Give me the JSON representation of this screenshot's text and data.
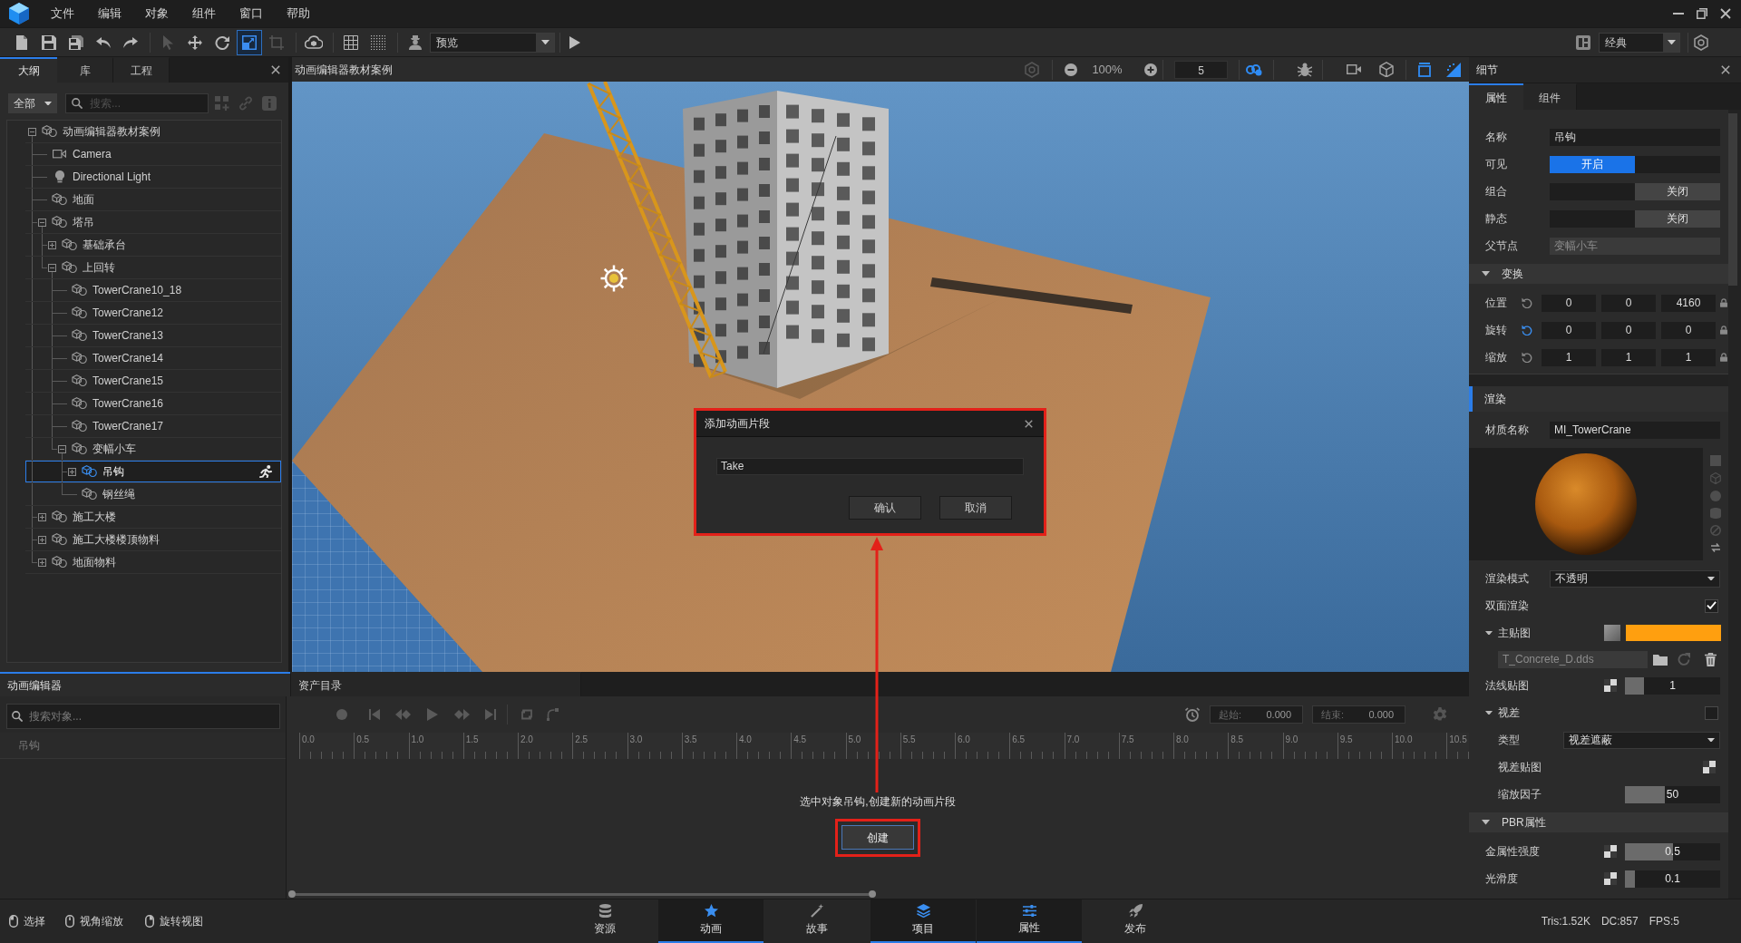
{
  "menu_bar": {
    "menus": [
      "文件",
      "编辑",
      "对象",
      "组件",
      "窗口",
      "帮助"
    ]
  },
  "toolbar": {
    "groups": [
      {
        "tools": [
          {
            "kind": "new",
            "selected": false,
            "disabled": false
          },
          {
            "kind": "save",
            "selected": false,
            "disabled": false
          },
          {
            "kind": "save-all",
            "selected": false,
            "disabled": false
          },
          {
            "kind": "undo",
            "selected": false,
            "disabled": false
          },
          {
            "kind": "redo",
            "selected": false,
            "disabled": false
          }
        ]
      },
      {
        "tools": [
          {
            "kind": "select",
            "selected": false,
            "disabled": true
          },
          {
            "kind": "move",
            "selected": false,
            "disabled": false
          },
          {
            "kind": "rotate",
            "selected": false,
            "disabled": false
          },
          {
            "kind": "scale",
            "selected": true,
            "disabled": false
          },
          {
            "kind": "snap",
            "selected": false,
            "disabled": true
          }
        ]
      },
      {
        "tools": [
          {
            "kind": "cloud",
            "selected": false,
            "disabled": false
          }
        ]
      },
      {
        "tools": [
          {
            "kind": "grid",
            "selected": false,
            "disabled": false
          },
          {
            "kind": "dot-grid",
            "selected": false,
            "disabled": false
          }
        ]
      }
    ],
    "preview_dropdown": "预览",
    "layout_dropdown": "经典"
  },
  "outliner": {
    "tabs": [
      {
        "label": "大纲",
        "selected": true
      },
      {
        "label": "库",
        "selected": false
      },
      {
        "label": "工程",
        "selected": false
      }
    ],
    "filter": "全部",
    "search_placeholder": "搜索...",
    "tree": [
      {
        "label": "动画编辑器教材案例",
        "kind": "object",
        "expanded": true,
        "selected": false,
        "animated": false,
        "children": [
          {
            "label": "Camera",
            "kind": "camera",
            "selected": false,
            "animated": false
          },
          {
            "label": "Directional Light",
            "kind": "light",
            "selected": false,
            "animated": false
          },
          {
            "label": "地面",
            "kind": "object",
            "selected": false,
            "animated": false
          },
          {
            "label": "塔吊",
            "kind": "object",
            "expanded": true,
            "selected": false,
            "animated": false,
            "children": [
              {
                "label": "基础承台",
                "kind": "object",
                "expanded": false,
                "selected": false,
                "animated": false
              },
              {
                "label": "上回转",
                "kind": "object",
                "expanded": true,
                "selected": false,
                "animated": false,
                "children": [
                  {
                    "label": "TowerCrane10_18",
                    "kind": "object",
                    "selected": false,
                    "animated": false
                  },
                  {
                    "label": "TowerCrane12",
                    "kind": "object",
                    "selected": false,
                    "animated": false
                  },
                  {
                    "label": "TowerCrane13",
                    "kind": "object",
                    "selected": false,
                    "animated": false
                  },
                  {
                    "label": "TowerCrane14",
                    "kind": "object",
                    "selected": false,
                    "animated": false
                  },
                  {
                    "label": "TowerCrane15",
                    "kind": "object",
                    "selected": false,
                    "animated": false
                  },
                  {
                    "label": "TowerCrane16",
                    "kind": "object",
                    "selected": false,
                    "animated": false
                  },
                  {
                    "label": "TowerCrane17",
                    "kind": "object",
                    "selected": false,
                    "animated": false
                  },
                  {
                    "label": "变幅小车",
                    "kind": "object",
                    "expanded": true,
                    "selected": false,
                    "animated": false,
                    "children": [
                      {
                        "label": "吊钩",
                        "kind": "object",
                        "expanded": false,
                        "selected": true,
                        "animated": true
                      },
                      {
                        "label": "钢丝绳",
                        "kind": "object",
                        "selected": false,
                        "animated": false
                      }
                    ]
                  }
                ]
              }
            ]
          },
          {
            "label": "施工大楼",
            "kind": "object",
            "expanded": false,
            "selected": false,
            "animated": false
          },
          {
            "label": "施工大楼楼顶物料",
            "kind": "object",
            "expanded": false,
            "selected": false,
            "animated": false
          },
          {
            "label": "地面物料",
            "kind": "object",
            "expanded": false,
            "selected": false,
            "animated": false
          }
        ]
      }
    ]
  },
  "viewport": {
    "title": "动画编辑器教材案例",
    "zoom": "100%",
    "number_field": "5",
    "tools": [
      {
        "kind": "link",
        "on": true
      },
      {
        "kind": "bug",
        "on": false
      },
      {
        "kind": "video-camera",
        "on": false
      },
      {
        "kind": "cube",
        "on": false
      },
      {
        "kind": "panel",
        "on": true
      },
      {
        "kind": "gradient",
        "on": true
      }
    ]
  },
  "dialog": {
    "title": "添加动画片段",
    "value": "Take",
    "buttons": [
      "确认",
      "取消"
    ],
    "highlighted": true
  },
  "details": {
    "title": "细节",
    "tabs": [
      {
        "label": "属性",
        "selected": true
      },
      {
        "label": "组件",
        "selected": false
      }
    ],
    "sections": [
      {
        "kind": "plain",
        "rows": [
          {
            "kind": "text",
            "label": "名称",
            "value": "吊钩",
            "disabled": false
          },
          {
            "kind": "toggle",
            "label": "可见",
            "on": true,
            "text": "开启"
          },
          {
            "kind": "toggle",
            "label": "组合",
            "on": false,
            "text": "关闭"
          },
          {
            "kind": "toggle",
            "label": "静态",
            "on": false,
            "text": "关闭"
          },
          {
            "kind": "text",
            "label": "父节点",
            "value": "变幅小车",
            "disabled": true
          }
        ]
      },
      {
        "kind": "group",
        "title": "变换",
        "expanded": true,
        "rows": [
          {
            "kind": "vector",
            "label": "位置",
            "values": [
              "0",
              "0",
              "4160"
            ],
            "highlighted": false
          },
          {
            "kind": "vector",
            "label": "旋转",
            "values": [
              "0",
              "0",
              "0"
            ],
            "highlighted": true
          },
          {
            "kind": "vector",
            "label": "缩放",
            "values": [
              "1",
              "1",
              "1"
            ],
            "highlighted": false
          }
        ]
      },
      {
        "kind": "category",
        "title": "渲染",
        "rows": [
          {
            "kind": "text",
            "label": "材质名称",
            "value": "MI_TowerCrane",
            "disabled": false
          },
          {
            "kind": "material-preview"
          },
          {
            "kind": "dropdown",
            "label": "渲染模式",
            "value": "不透明"
          },
          {
            "kind": "checkbox",
            "label": "双面渲染",
            "checked": true
          },
          {
            "kind": "texture",
            "label": "主贴图",
            "expanded": true,
            "color": "#ff9f0f",
            "children": [
              {
                "kind": "file",
                "value": "T_Concrete_D.dds"
              }
            ]
          },
          {
            "kind": "slider",
            "label": "法线贴图",
            "map": true,
            "level": 0.2,
            "value": "1"
          },
          {
            "kind": "group",
            "label": "视差",
            "expanded": true,
            "checked": false,
            "children": [
              {
                "kind": "dropdown",
                "label": "类型",
                "value": "视差遮蔽"
              },
              {
                "kind": "map",
                "label": "视差贴图"
              },
              {
                "kind": "slider",
                "label": "缩放因子",
                "map": false,
                "level": 0.42,
                "value": "50"
              }
            ]
          }
        ]
      },
      {
        "kind": "group",
        "title": "PBR属性",
        "expanded": true,
        "rows": [
          {
            "kind": "slider",
            "label": "金属性强度",
            "map": true,
            "level": 0.5,
            "value": "0.5"
          },
          {
            "kind": "slider",
            "label": "光滑度",
            "map": true,
            "level": 0.1,
            "value": "0.1"
          }
        ]
      }
    ]
  },
  "animation_editor": {
    "tabs": [
      {
        "label": "动画编辑器",
        "selected": true
      },
      {
        "label": "资产目录",
        "selected": false
      }
    ],
    "search_placeholder": "搜索对象...",
    "transport": [
      {
        "kind": "record",
        "disabled": true
      },
      {
        "kind": "skip-start",
        "disabled": true
      },
      {
        "kind": "prev-key",
        "disabled": true
      },
      {
        "kind": "play",
        "disabled": true
      },
      {
        "kind": "next-key",
        "disabled": true
      },
      {
        "kind": "skip-end",
        "disabled": true
      },
      {
        "kind": "loop",
        "disabled": true
      },
      {
        "kind": "curve",
        "disabled": true
      }
    ],
    "start": {
      "label": "起始:",
      "value": "0.000"
    },
    "end": {
      "label": "结束:",
      "value": "0.000"
    },
    "ruler": [
      "0.0",
      "0.5",
      "1.0",
      "1.5",
      "2.0",
      "2.5",
      "3.0",
      "3.5",
      "4.0",
      "4.5",
      "5.0",
      "5.5",
      "6.0",
      "6.5",
      "7.0",
      "7.5",
      "8.0",
      "8.5",
      "9.0",
      "9.5",
      "10.0",
      "10.5"
    ],
    "tracks": [
      "吊钩"
    ],
    "message": "选中对象吊钩,创建新的动画片段",
    "create_button": {
      "label": "创建",
      "highlighted": true
    }
  },
  "status_bar": {
    "hints": [
      {
        "kind": "left",
        "label": "选择"
      },
      {
        "kind": "wheel",
        "label": "视角缩放"
      },
      {
        "kind": "right",
        "label": "旋转视图"
      }
    ],
    "tabs": [
      {
        "kind": "assets",
        "label": "资源",
        "selected": false
      },
      {
        "kind": "animation",
        "label": "动画",
        "selected": true
      },
      {
        "kind": "story",
        "label": "故事",
        "selected": false
      },
      {
        "kind": "project",
        "label": "项目",
        "selected": true
      },
      {
        "kind": "properties",
        "label": "属性",
        "selected": true
      },
      {
        "kind": "publish",
        "label": "发布",
        "selected": false
      }
    ],
    "stats": [
      "Tris:1.52K",
      "DC:857",
      "FPS:5"
    ]
  }
}
